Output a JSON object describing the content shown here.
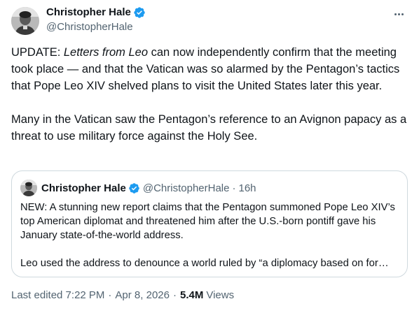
{
  "author": {
    "name": "Christopher Hale",
    "handle": "@ChristopherHale",
    "verified": true
  },
  "tweet": {
    "p1_prefix": "UPDATE: ",
    "p1_emph": "Letters from Leo",
    "p1_rest": " can now independently confirm that the meeting took place — and that the Vatican was so alarmed by the Pentagon’s tactics that Pope Leo XIV shelved plans to visit the United States later this year.",
    "p2": "Many in the Vatican saw the Pentagon’s reference to an Avignon papacy as a threat to use military force against the Holy See."
  },
  "quote": {
    "name": "Christopher Hale",
    "handle": "@ChristopherHale",
    "separator": "·",
    "time": "16h",
    "p1": "NEW: A stunning new report claims that the Pentagon summoned Pope Leo XIV’s top American diplomat and threatened him after the U.S.-born pontiff gave his January state-of-the-world address.",
    "p2": "Leo used the address to denounce a world ruled by “a diplomacy based on for…"
  },
  "footer": {
    "edited": "Last edited 7:22 PM",
    "separator": "·",
    "date": "Apr 8, 2026",
    "views_count": "5.4M",
    "views_label": "Views"
  },
  "colors": {
    "text": "#0f1419",
    "secondary": "#536471",
    "verified": "#1d9bf0",
    "border": "#cfd9de"
  },
  "icons": {
    "verified": "verified-badge-icon",
    "more": "more-horizontal-icon"
  }
}
